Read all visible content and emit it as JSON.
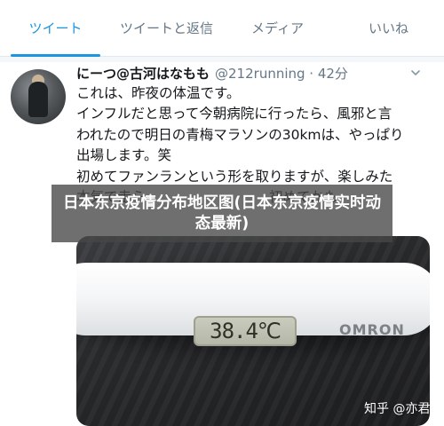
{
  "tabs": [
    {
      "label": "ツイート",
      "active": true
    },
    {
      "label": "ツイートと返信",
      "active": false
    },
    {
      "label": "メディア",
      "active": false
    },
    {
      "label": "いいね",
      "active": false
    }
  ],
  "tweet": {
    "display_name": "にーつ@古河はなもも",
    "handle_time": "@212running · 42分",
    "text": "これは、昨夜の体温です。\nインフルだと思って今朝病院に行ったら、風邪と言\nわれたので明日の青梅マラソンの30kmは、やっぱり\n出場します。笑\n初めてファンランという形を取りますが、楽しみた\n本気で走ら　　　　　　　　　初めてかも",
    "photo": {
      "display_reading": "38.4℃",
      "brand_text": "OMRON"
    }
  },
  "banner": {
    "text": "日本东京疫情分布地区图(日本东京疫情实时动态最新)"
  },
  "watermark": {
    "text": "知乎 @亦君"
  },
  "colors": {
    "accent": "#1b95e0",
    "muted": "#657786",
    "banner_bg": "rgba(70,70,70,0.78)"
  },
  "icons": {
    "caret": "chevron-down-icon"
  }
}
